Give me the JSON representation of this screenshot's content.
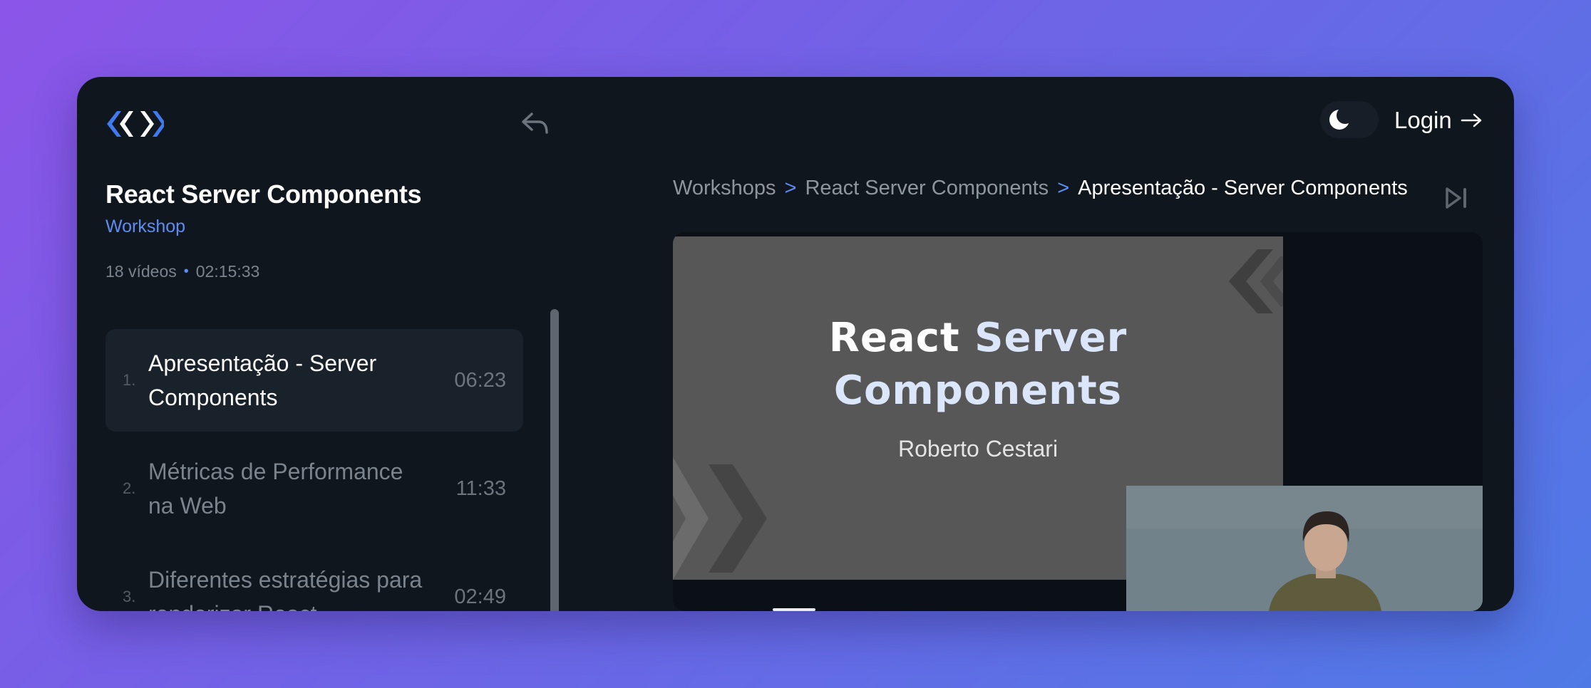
{
  "header": {
    "logo_icon": "code-brackets-logo-icon",
    "back_icon": "reply-arrow-icon",
    "theme_icon": "moon-icon",
    "login_label": "Login",
    "login_icon": "arrow-right-icon"
  },
  "course": {
    "title": "React Server Components",
    "kind": "Workshop",
    "videos": "18 vídeos",
    "bullet": "•",
    "total_duration": "02:15:33"
  },
  "playlist": [
    {
      "number": "1.",
      "title": "Apresentação - Server Components",
      "duration": "06:23",
      "active": true
    },
    {
      "number": "2.",
      "title": "Métricas de Performance na Web",
      "duration": "11:33",
      "active": false
    },
    {
      "number": "3.",
      "title": "Diferentes estratégias para renderizar React",
      "duration": "02:49",
      "active": false
    }
  ],
  "breadcrumb": {
    "items": [
      "Workshops",
      "React Server Components",
      "Apresentação - Server Components"
    ],
    "separator": ">",
    "skip_icon": "skip-next-icon"
  },
  "player": {
    "slide_line1_white": "React",
    "slide_line1_blue": "Server",
    "slide_line2": "Components",
    "slide_author": "Roberto Cestari"
  },
  "colors": {
    "background": "#10161d",
    "accent": "#5d8cf2",
    "active_item": "#19212b",
    "slide": "#575757"
  }
}
